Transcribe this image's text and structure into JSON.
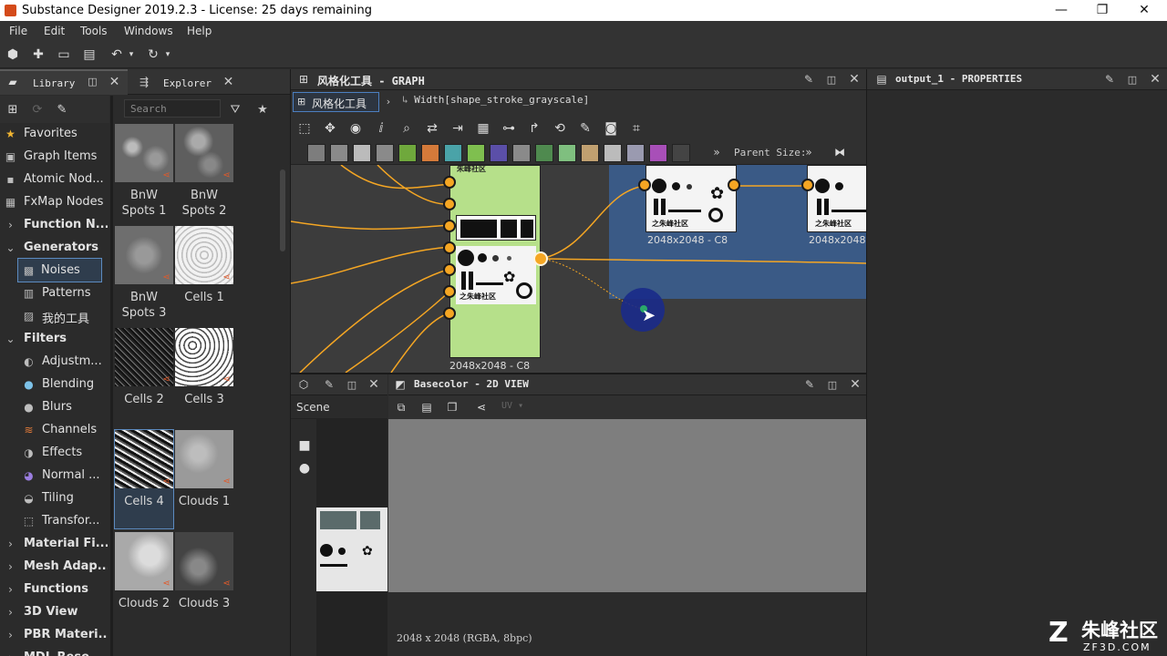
{
  "window": {
    "title": "Substance Designer 2019.2.3 - License: 25 days remaining"
  },
  "menu": [
    "File",
    "Edit",
    "Tools",
    "Windows",
    "Help"
  ],
  "library": {
    "tab_library": "Library",
    "tab_explorer": "Explorer",
    "search_placeholder": "Search",
    "tree": [
      {
        "label": "Favorites",
        "icon": "star-icon",
        "level": 0,
        "bold": false
      },
      {
        "label": "Graph Items",
        "icon": "graph-items-icon",
        "level": 0,
        "bold": false
      },
      {
        "label": "Atomic Nod...",
        "icon": "atomic-nodes-icon",
        "level": 0,
        "bold": false
      },
      {
        "label": "FxMap Nodes",
        "icon": "fxmap-icon",
        "level": 0,
        "bold": false
      },
      {
        "label": "Function N...",
        "icon": "chevron-right-icon",
        "level": 0,
        "bold": true
      },
      {
        "label": "Generators",
        "icon": "chevron-down-icon",
        "level": 0,
        "bold": true
      },
      {
        "label": "Noises",
        "icon": "noise-icon",
        "level": 1,
        "bold": false,
        "selected": true
      },
      {
        "label": "Patterns",
        "icon": "patterns-icon",
        "level": 1,
        "bold": false
      },
      {
        "label": "我的工具",
        "icon": "tools-icon",
        "level": 1,
        "bold": false
      },
      {
        "label": "Filters",
        "icon": "chevron-down-icon",
        "level": 0,
        "bold": true
      },
      {
        "label": "Adjustm...",
        "icon": "adjustment-icon",
        "level": 1,
        "bold": false
      },
      {
        "label": "Blending",
        "icon": "blending-icon",
        "level": 1,
        "bold": false
      },
      {
        "label": "Blurs",
        "icon": "blur-icon",
        "level": 1,
        "bold": false
      },
      {
        "label": "Channels",
        "icon": "channels-icon",
        "level": 1,
        "bold": false
      },
      {
        "label": "Effects",
        "icon": "effects-icon",
        "level": 1,
        "bold": false
      },
      {
        "label": "Normal ...",
        "icon": "normal-icon",
        "level": 1,
        "bold": false
      },
      {
        "label": "Tiling",
        "icon": "tiling-icon",
        "level": 1,
        "bold": false
      },
      {
        "label": "Transfor...",
        "icon": "transform-icon",
        "level": 1,
        "bold": false
      },
      {
        "label": "Material Fi...",
        "icon": "chevron-right-icon",
        "level": 0,
        "bold": true
      },
      {
        "label": "Mesh Adap...",
        "icon": "chevron-right-icon",
        "level": 0,
        "bold": true
      },
      {
        "label": "Functions",
        "icon": "chevron-right-icon",
        "level": 0,
        "bold": true
      },
      {
        "label": "3D View",
        "icon": "chevron-right-icon",
        "level": 0,
        "bold": true
      },
      {
        "label": "PBR Materi...",
        "icon": "chevron-right-icon",
        "level": 0,
        "bold": true
      },
      {
        "label": "MDL Reso...",
        "icon": "chevron-right-icon",
        "level": 0,
        "bold": true
      }
    ],
    "thumbnails": [
      {
        "label": "BnW\nSpots 1"
      },
      {
        "label": "BnW\nSpots 2"
      },
      {
        "label": "BnW\nSpots 3"
      },
      {
        "label": "Cells 1"
      },
      {
        "label": "Cells 2"
      },
      {
        "label": "Cells 3"
      },
      {
        "label": "Cells 4",
        "selected": true
      },
      {
        "label": "Clouds 1"
      },
      {
        "label": "Clouds 2"
      },
      {
        "label": "Clouds 3"
      }
    ]
  },
  "graph": {
    "title": "风格化工具 - GRAPH",
    "breadcrumb_root": "风格化工具",
    "breadcrumb_item": "Width[shape_stroke_grayscale]",
    "parent_size_label": "Parent Size:",
    "node_main_label": "2048x2048 - C8",
    "node_right1_label": "2048x2048 - C8",
    "node_right2_label": "2048x2048",
    "node_logo_text": "之朱峰社区",
    "node_top_text": "朱峰社区"
  },
  "properties": {
    "title": "output_1 - PROPERTIES"
  },
  "scene": {
    "label": "Scene"
  },
  "view2d": {
    "title": "Basecolor - 2D VIEW",
    "uv_label": "UV",
    "status": "2048 x 2048 (RGBA, 8bpc)"
  },
  "watermark": {
    "cn": "朱峰社区",
    "url": "ZF3D.COM"
  },
  "colors": {
    "accent_orange": "#f5a623",
    "frame_blue": "#3a5a86",
    "node_green": "#b6e08a"
  }
}
